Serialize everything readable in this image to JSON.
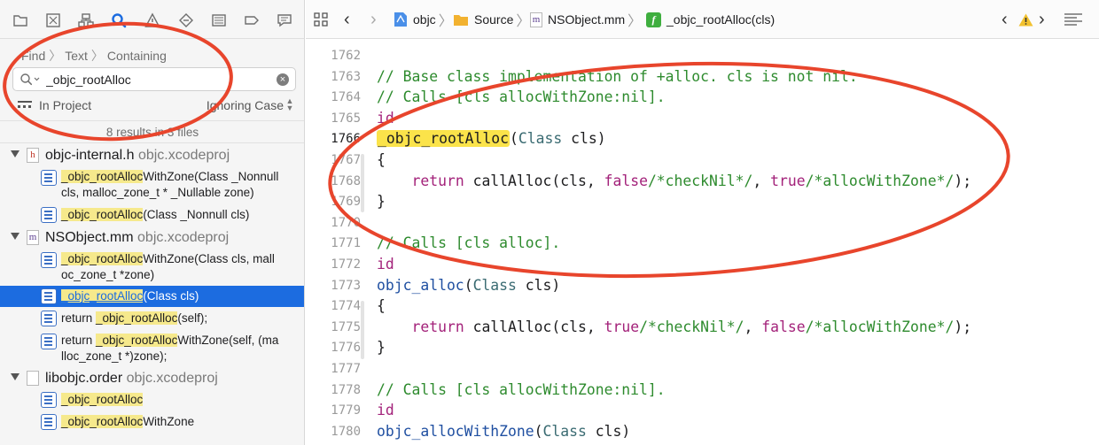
{
  "navigator": {
    "toolbar_icons": [
      "folder-icon",
      "source-control-icon",
      "hierarchy-icon",
      "find-icon",
      "warning-icon",
      "test-icon",
      "debug-icon",
      "breakpoint-icon",
      "report-icon"
    ],
    "find_path": [
      "Find",
      "Text",
      "Containing"
    ],
    "search": {
      "value": "_objc_rootAlloc",
      "placeholder": ""
    },
    "scope": "In Project",
    "case_mode": "Ignoring Case",
    "summary": "8 results in 3 files",
    "groups": [
      {
        "file": "objc-internal.h",
        "project": "objc.xcodeproj",
        "results": [
          {
            "match": "_objc_rootAlloc",
            "rest1": "WithZone(Class _Nonnull",
            "line2": "cls, malloc_zone_t * _Nullable zone)"
          },
          {
            "match": "_objc_rootAlloc",
            "rest1": "(Class _Nonnull cls)",
            "line2": ""
          }
        ]
      },
      {
        "file": "NSObject.mm",
        "project": "objc.xcodeproj",
        "results": [
          {
            "match": "_objc_rootAlloc",
            "rest1": "WithZone(Class cls, mall",
            "line2": "oc_zone_t *zone)"
          },
          {
            "match": "_objc_rootAlloc",
            "rest1": "(Class cls)",
            "line2": "",
            "selected": true
          },
          {
            "prefix": "return ",
            "match": "_objc_rootAlloc",
            "rest1": "(self);",
            "line2": ""
          },
          {
            "prefix": "return ",
            "match": "_objc_rootAlloc",
            "rest1": "WithZone(self, (ma",
            "line2": "lloc_zone_t *)zone);"
          }
        ]
      },
      {
        "file": "libobjc.order",
        "project": "objc.xcodeproj",
        "results": [
          {
            "match": "_objc_rootAlloc",
            "rest1": "",
            "line2": ""
          },
          {
            "match": "_objc_rootAlloc",
            "rest1": "WithZone",
            "line2": ""
          }
        ]
      }
    ]
  },
  "jump_bar": {
    "crumbs": [
      "objc",
      "Source",
      "NSObject.mm",
      "_objc_rootAlloc(cls)"
    ],
    "file_letter": "m",
    "func_letter": "f"
  },
  "editor": {
    "current_line": 1766,
    "lines": [
      {
        "n": 1762,
        "tokens": []
      },
      {
        "n": 1763,
        "tokens": [
          [
            "comment",
            "// Base class implementation of +alloc. cls is not nil."
          ]
        ]
      },
      {
        "n": 1764,
        "tokens": [
          [
            "comment",
            "// Calls [cls allocWithZone:nil]."
          ]
        ]
      },
      {
        "n": 1765,
        "tokens": [
          [
            "keyword",
            "id"
          ]
        ]
      },
      {
        "n": 1766,
        "tokens": [
          [
            "match",
            "_objc_rootAlloc"
          ],
          [
            "plain",
            "("
          ],
          [
            "type",
            "Class"
          ],
          [
            "plain",
            " cls)"
          ]
        ]
      },
      {
        "n": 1767,
        "tokens": [
          [
            "plain",
            "{"
          ]
        ]
      },
      {
        "n": 1768,
        "tokens": [
          [
            "plain",
            "    "
          ],
          [
            "keyword",
            "return"
          ],
          [
            "plain",
            " callAlloc(cls, "
          ],
          [
            "keyword",
            "false"
          ],
          [
            "comment",
            "/*checkNil*/"
          ],
          [
            "plain",
            ", "
          ],
          [
            "keyword",
            "true"
          ],
          [
            "comment",
            "/*allocWithZone*/"
          ],
          [
            "plain",
            ");"
          ]
        ]
      },
      {
        "n": 1769,
        "tokens": [
          [
            "plain",
            "}"
          ]
        ]
      },
      {
        "n": 1770,
        "tokens": []
      },
      {
        "n": 1771,
        "tokens": [
          [
            "comment",
            "// Calls [cls alloc]."
          ]
        ]
      },
      {
        "n": 1772,
        "tokens": [
          [
            "keyword",
            "id"
          ]
        ]
      },
      {
        "n": 1773,
        "tokens": [
          [
            "func",
            "objc_alloc"
          ],
          [
            "plain",
            "("
          ],
          [
            "type",
            "Class"
          ],
          [
            "plain",
            " cls)"
          ]
        ]
      },
      {
        "n": 1774,
        "tokens": [
          [
            "plain",
            "{"
          ]
        ]
      },
      {
        "n": 1775,
        "tokens": [
          [
            "plain",
            "    "
          ],
          [
            "keyword",
            "return"
          ],
          [
            "plain",
            " callAlloc(cls, "
          ],
          [
            "keyword",
            "true"
          ],
          [
            "comment",
            "/*checkNil*/"
          ],
          [
            "plain",
            ", "
          ],
          [
            "keyword",
            "false"
          ],
          [
            "comment",
            "/*allocWithZone*/"
          ],
          [
            "plain",
            ");"
          ]
        ]
      },
      {
        "n": 1776,
        "tokens": [
          [
            "plain",
            "}"
          ]
        ]
      },
      {
        "n": 1777,
        "tokens": []
      },
      {
        "n": 1778,
        "tokens": [
          [
            "comment",
            "// Calls [cls allocWithZone:nil]."
          ]
        ]
      },
      {
        "n": 1779,
        "tokens": [
          [
            "keyword",
            "id"
          ]
        ]
      },
      {
        "n": 1780,
        "tokens": [
          [
            "func",
            "objc_allocWithZone"
          ],
          [
            "plain",
            "("
          ],
          [
            "type",
            "Class"
          ],
          [
            "plain",
            " cls)"
          ]
        ]
      }
    ]
  },
  "colors": {
    "accent": "#1c6ce0",
    "annotation": "#e8452c",
    "match_highlight": "#fbe34a",
    "comment": "#2e8b2e",
    "keyword": "#a3227a"
  }
}
